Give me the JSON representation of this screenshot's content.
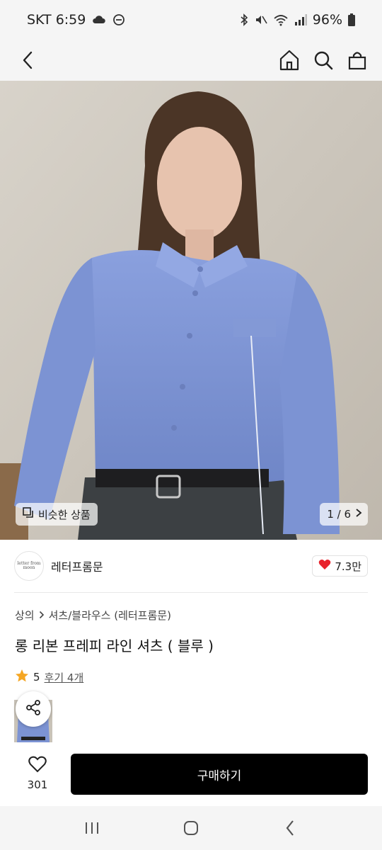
{
  "status_bar": {
    "carrier_time": "SKT 6:59",
    "battery": "96%",
    "icons": [
      "weather-icon",
      "dnd-icon",
      "bluetooth-icon",
      "mute-icon",
      "wifi-icon",
      "signal-icon",
      "battery-icon"
    ]
  },
  "header": {
    "icons": [
      "back-icon",
      "home-icon",
      "search-icon",
      "shopping-bag-icon"
    ]
  },
  "gallery": {
    "similar_label": "비슷한 상품",
    "pager": "1 / 6"
  },
  "brand": {
    "logo_text": "letter from moon",
    "name": "레터프롬문",
    "likes": "7.3만"
  },
  "product": {
    "breadcrumb_category": "상의",
    "breadcrumb_sub": "셔츠/블라우스 (레터프롬문)",
    "title": "롱 리본 프레피 라인 셔츠 ( 블루 )",
    "rating": "5",
    "review_link": "후기 4개"
  },
  "bottom": {
    "wish_count": "301",
    "buy_label": "구매하기"
  },
  "nav": {
    "icons": [
      "recents-icon",
      "home-nav-icon",
      "back-nav-icon"
    ]
  },
  "colors": {
    "buy_button": "#000000",
    "heart": "#e8232c",
    "star": "#f5a623",
    "shirt": "#7f96d6"
  }
}
